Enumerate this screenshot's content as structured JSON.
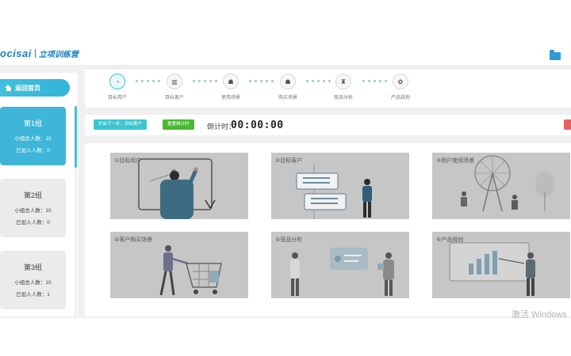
{
  "header": {
    "logo_word": "ocisai",
    "logo_cn": "立项训练营"
  },
  "sidebar": {
    "home_label": "返回首页",
    "groups": [
      {
        "title": "第1组",
        "total_label": "小组总人数：",
        "total": "10",
        "joined_label": "已加入人数：",
        "joined": "0",
        "active": true
      },
      {
        "title": "第2组",
        "total_label": "小组总人数：",
        "total": "10",
        "joined_label": "已加入人数：",
        "joined": "0",
        "active": false
      },
      {
        "title": "第3组",
        "total_label": "小组总人数：",
        "total": "10",
        "joined_label": "已加入人数：",
        "joined": "1",
        "active": false
      }
    ]
  },
  "stepper": {
    "steps": [
      {
        "label": "目标用户",
        "icon": "target-user-icon"
      },
      {
        "label": "目标客户",
        "icon": "target-customer-icon"
      },
      {
        "label": "使用场景",
        "icon": "usage-scene-icon"
      },
      {
        "label": "购买场景",
        "icon": "purchase-scene-icon"
      },
      {
        "label": "竞品分析",
        "icon": "competitor-icon"
      },
      {
        "label": "产品规划",
        "icon": "palette-icon"
      }
    ]
  },
  "toolbar": {
    "next_step_label": "开启下一步：目标客户",
    "reset_timer_label": "重置倒计时",
    "timer_label": "倒计时：",
    "timer_value": "00:00:00"
  },
  "tiles": [
    {
      "label": "①目标用户"
    },
    {
      "label": "②目标客户"
    },
    {
      "label": "③用户使用场景"
    },
    {
      "label": "④客户购买场景"
    },
    {
      "label": "⑤竞品分析"
    },
    {
      "label": "⑥产品规划"
    }
  ],
  "watermark": "激活 Windows",
  "colors": {
    "accent": "#3fb6d9",
    "green": "#49b832",
    "teal": "#3fc4cf",
    "red": "#e66262"
  }
}
